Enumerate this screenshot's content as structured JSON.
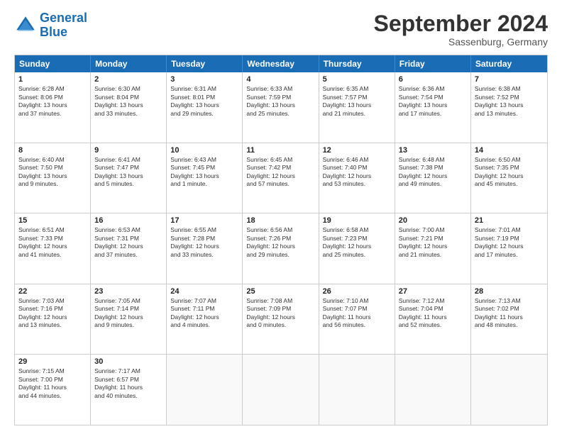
{
  "header": {
    "logo_line1": "General",
    "logo_line2": "Blue",
    "month_title": "September 2024",
    "location": "Sassenburg, Germany"
  },
  "days_of_week": [
    "Sunday",
    "Monday",
    "Tuesday",
    "Wednesday",
    "Thursday",
    "Friday",
    "Saturday"
  ],
  "weeks": [
    [
      {
        "day": 1,
        "lines": [
          "Sunrise: 6:28 AM",
          "Sunset: 8:06 PM",
          "Daylight: 13 hours",
          "and 37 minutes."
        ]
      },
      {
        "day": 2,
        "lines": [
          "Sunrise: 6:30 AM",
          "Sunset: 8:04 PM",
          "Daylight: 13 hours",
          "and 33 minutes."
        ]
      },
      {
        "day": 3,
        "lines": [
          "Sunrise: 6:31 AM",
          "Sunset: 8:01 PM",
          "Daylight: 13 hours",
          "and 29 minutes."
        ]
      },
      {
        "day": 4,
        "lines": [
          "Sunrise: 6:33 AM",
          "Sunset: 7:59 PM",
          "Daylight: 13 hours",
          "and 25 minutes."
        ]
      },
      {
        "day": 5,
        "lines": [
          "Sunrise: 6:35 AM",
          "Sunset: 7:57 PM",
          "Daylight: 13 hours",
          "and 21 minutes."
        ]
      },
      {
        "day": 6,
        "lines": [
          "Sunrise: 6:36 AM",
          "Sunset: 7:54 PM",
          "Daylight: 13 hours",
          "and 17 minutes."
        ]
      },
      {
        "day": 7,
        "lines": [
          "Sunrise: 6:38 AM",
          "Sunset: 7:52 PM",
          "Daylight: 13 hours",
          "and 13 minutes."
        ]
      }
    ],
    [
      {
        "day": 8,
        "lines": [
          "Sunrise: 6:40 AM",
          "Sunset: 7:50 PM",
          "Daylight: 13 hours",
          "and 9 minutes."
        ]
      },
      {
        "day": 9,
        "lines": [
          "Sunrise: 6:41 AM",
          "Sunset: 7:47 PM",
          "Daylight: 13 hours",
          "and 5 minutes."
        ]
      },
      {
        "day": 10,
        "lines": [
          "Sunrise: 6:43 AM",
          "Sunset: 7:45 PM",
          "Daylight: 13 hours",
          "and 1 minute."
        ]
      },
      {
        "day": 11,
        "lines": [
          "Sunrise: 6:45 AM",
          "Sunset: 7:42 PM",
          "Daylight: 12 hours",
          "and 57 minutes."
        ]
      },
      {
        "day": 12,
        "lines": [
          "Sunrise: 6:46 AM",
          "Sunset: 7:40 PM",
          "Daylight: 12 hours",
          "and 53 minutes."
        ]
      },
      {
        "day": 13,
        "lines": [
          "Sunrise: 6:48 AM",
          "Sunset: 7:38 PM",
          "Daylight: 12 hours",
          "and 49 minutes."
        ]
      },
      {
        "day": 14,
        "lines": [
          "Sunrise: 6:50 AM",
          "Sunset: 7:35 PM",
          "Daylight: 12 hours",
          "and 45 minutes."
        ]
      }
    ],
    [
      {
        "day": 15,
        "lines": [
          "Sunrise: 6:51 AM",
          "Sunset: 7:33 PM",
          "Daylight: 12 hours",
          "and 41 minutes."
        ]
      },
      {
        "day": 16,
        "lines": [
          "Sunrise: 6:53 AM",
          "Sunset: 7:31 PM",
          "Daylight: 12 hours",
          "and 37 minutes."
        ]
      },
      {
        "day": 17,
        "lines": [
          "Sunrise: 6:55 AM",
          "Sunset: 7:28 PM",
          "Daylight: 12 hours",
          "and 33 minutes."
        ]
      },
      {
        "day": 18,
        "lines": [
          "Sunrise: 6:56 AM",
          "Sunset: 7:26 PM",
          "Daylight: 12 hours",
          "and 29 minutes."
        ]
      },
      {
        "day": 19,
        "lines": [
          "Sunrise: 6:58 AM",
          "Sunset: 7:23 PM",
          "Daylight: 12 hours",
          "and 25 minutes."
        ]
      },
      {
        "day": 20,
        "lines": [
          "Sunrise: 7:00 AM",
          "Sunset: 7:21 PM",
          "Daylight: 12 hours",
          "and 21 minutes."
        ]
      },
      {
        "day": 21,
        "lines": [
          "Sunrise: 7:01 AM",
          "Sunset: 7:19 PM",
          "Daylight: 12 hours",
          "and 17 minutes."
        ]
      }
    ],
    [
      {
        "day": 22,
        "lines": [
          "Sunrise: 7:03 AM",
          "Sunset: 7:16 PM",
          "Daylight: 12 hours",
          "and 13 minutes."
        ]
      },
      {
        "day": 23,
        "lines": [
          "Sunrise: 7:05 AM",
          "Sunset: 7:14 PM",
          "Daylight: 12 hours",
          "and 9 minutes."
        ]
      },
      {
        "day": 24,
        "lines": [
          "Sunrise: 7:07 AM",
          "Sunset: 7:11 PM",
          "Daylight: 12 hours",
          "and 4 minutes."
        ]
      },
      {
        "day": 25,
        "lines": [
          "Sunrise: 7:08 AM",
          "Sunset: 7:09 PM",
          "Daylight: 12 hours",
          "and 0 minutes."
        ]
      },
      {
        "day": 26,
        "lines": [
          "Sunrise: 7:10 AM",
          "Sunset: 7:07 PM",
          "Daylight: 11 hours",
          "and 56 minutes."
        ]
      },
      {
        "day": 27,
        "lines": [
          "Sunrise: 7:12 AM",
          "Sunset: 7:04 PM",
          "Daylight: 11 hours",
          "and 52 minutes."
        ]
      },
      {
        "day": 28,
        "lines": [
          "Sunrise: 7:13 AM",
          "Sunset: 7:02 PM",
          "Daylight: 11 hours",
          "and 48 minutes."
        ]
      }
    ],
    [
      {
        "day": 29,
        "lines": [
          "Sunrise: 7:15 AM",
          "Sunset: 7:00 PM",
          "Daylight: 11 hours",
          "and 44 minutes."
        ]
      },
      {
        "day": 30,
        "lines": [
          "Sunrise: 7:17 AM",
          "Sunset: 6:57 PM",
          "Daylight: 11 hours",
          "and 40 minutes."
        ]
      },
      {
        "day": null,
        "lines": []
      },
      {
        "day": null,
        "lines": []
      },
      {
        "day": null,
        "lines": []
      },
      {
        "day": null,
        "lines": []
      },
      {
        "day": null,
        "lines": []
      }
    ]
  ]
}
